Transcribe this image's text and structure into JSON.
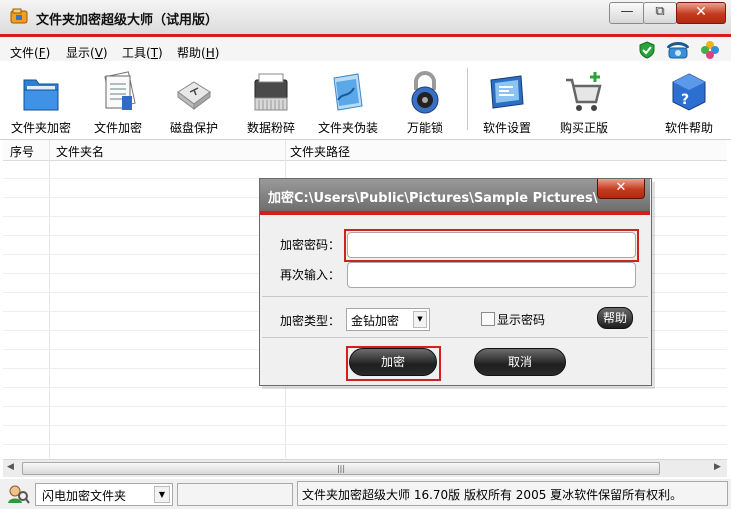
{
  "window": {
    "title": "文件夹加密超级大师（试用版）",
    "controls": [
      "minimize",
      "restore",
      "close"
    ]
  },
  "menu": [
    {
      "label": "文件(",
      "key": "F",
      "end": ")"
    },
    {
      "label": "显示(",
      "key": "V",
      "end": ")"
    },
    {
      "label": "工具(",
      "key": "T",
      "end": ")"
    },
    {
      "label": "帮助(",
      "key": "H",
      "end": ")"
    }
  ],
  "toolbar": [
    {
      "label": "文件夹加密",
      "icon": "folder-blue-icon"
    },
    {
      "label": "文件加密",
      "icon": "document-icon"
    },
    {
      "label": "磁盘保护",
      "icon": "usb-drive-icon"
    },
    {
      "label": "数据粉碎",
      "icon": "shredder-icon"
    },
    {
      "label": "文件夹伪装",
      "icon": "folder-disguise-icon"
    },
    {
      "label": "万能锁",
      "icon": "padlock-icon"
    },
    {
      "label": "软件设置",
      "icon": "settings-monitor-icon"
    },
    {
      "label": "购买正版",
      "icon": "shopping-cart-icon"
    },
    {
      "label": "软件帮助",
      "icon": "help-cube-icon"
    }
  ],
  "list": {
    "columns": [
      "序号",
      "文件夹名",
      "文件夹路径"
    ],
    "rows": []
  },
  "dialog": {
    "title": "加密C:\\Users\\Public\\Pictures\\Sample Pictures\\",
    "password_label": "加密密码：",
    "password_value": "",
    "confirm_label": "再次输入：",
    "confirm_value": "",
    "type_label": "加密类型：",
    "type_selected": "金钻加密",
    "show_password_label": "显示密码",
    "show_password_checked": false,
    "help_button": "帮助",
    "ok_button": "加密",
    "cancel_button": "取消"
  },
  "statusbar": {
    "mode_select": "闪电加密文件夹",
    "progress_text": "",
    "copyright": "文件夹加密超级大师 16.70版 版权所有 2005 夏冰软件保留所有权利。"
  },
  "colors": {
    "accent_red": "#d61d1d",
    "dialog_title_bg": "#7f7f7f",
    "dark_button": "#2a2a2a"
  }
}
